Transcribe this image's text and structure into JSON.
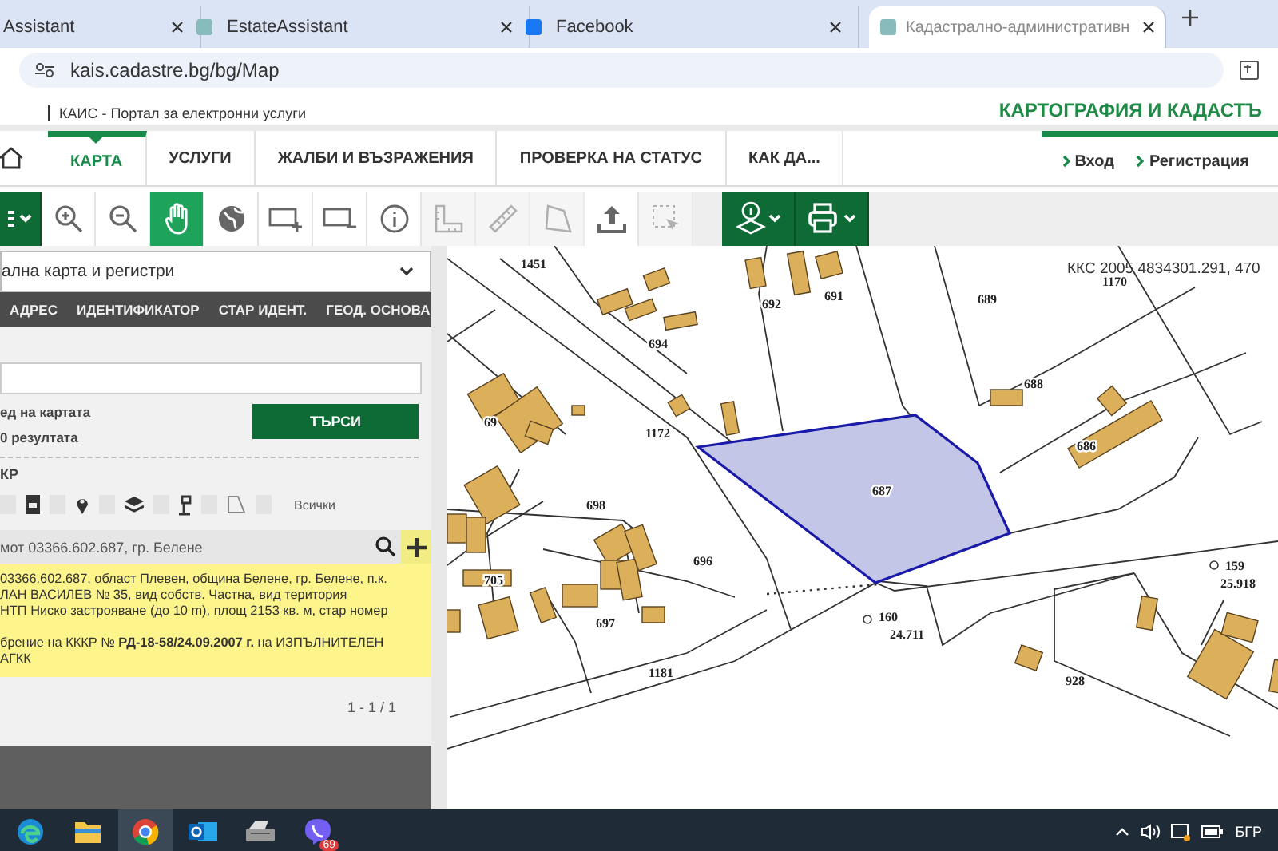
{
  "browser": {
    "tabs": [
      {
        "title": "Assistant",
        "selected": false
      },
      {
        "title": "EstateAssistant",
        "selected": false
      },
      {
        "title": "Facebook",
        "selected": false
      },
      {
        "title": "Кадастрално-административн",
        "selected": true
      }
    ],
    "url": "kais.cadastre.bg/bg/Map"
  },
  "site_header": {
    "title": "КАИС - Портал за електронни услуги",
    "agency": "КАРТОГРАФИЯ И КАДАСТЪ"
  },
  "nav": {
    "items": [
      {
        "label": "КАРТА",
        "selected": true
      },
      {
        "label": "УСЛУГИ",
        "selected": false
      },
      {
        "label": "ЖАЛБИ И ВЪЗРАЖЕНИЯ",
        "selected": false
      },
      {
        "label": "ПРОВЕРКА НА СТАТУС",
        "selected": false
      },
      {
        "label": "КАК ДА...",
        "selected": false
      }
    ],
    "links": [
      "Вход",
      "Регистрация"
    ]
  },
  "toolbar": {
    "tools": [
      {
        "kind": "menu",
        "selected": false,
        "disabled": false
      },
      {
        "kind": "zoom-in",
        "selected": false,
        "disabled": false
      },
      {
        "kind": "zoom-out",
        "selected": false,
        "disabled": false
      },
      {
        "kind": "hand",
        "selected": true,
        "disabled": false
      },
      {
        "kind": "globe",
        "selected": false,
        "disabled": false
      },
      {
        "kind": "rect-plus",
        "selected": false,
        "disabled": false
      },
      {
        "kind": "rect-minus",
        "selected": false,
        "disabled": false
      },
      {
        "kind": "info",
        "selected": false,
        "disabled": false
      },
      {
        "kind": "ruler-square",
        "selected": false,
        "disabled": true
      },
      {
        "kind": "ruler",
        "selected": false,
        "disabled": true
      },
      {
        "kind": "polygon",
        "selected": false,
        "disabled": true
      },
      {
        "kind": "upload",
        "selected": false,
        "disabled": false
      },
      {
        "kind": "select-box",
        "selected": false,
        "disabled": true
      },
      {
        "kind": "layer-info",
        "selected": false,
        "disabled": false
      },
      {
        "kind": "print",
        "selected": false,
        "disabled": false
      }
    ]
  },
  "search_panel": {
    "source": "ална карта и регистри",
    "tabs": [
      {
        "label": "АДРЕС",
        "selected": false
      },
      {
        "label": "ИДЕНТИФИКАТОР",
        "selected": false
      },
      {
        "label": "СТАР ИДЕНТ.",
        "selected": false
      },
      {
        "label": "ГЕОД. ОСНОВА",
        "selected": false
      }
    ],
    "options": [
      "ед на картата",
      "0 резултата"
    ],
    "search_button": "ТЪРСИ",
    "layer_group": "КР",
    "filters": [
      {
        "checked": false
      },
      {
        "checked": false
      },
      {
        "checked": false
      },
      {
        "checked": false
      },
      {
        "checked": false
      },
      {
        "checked": false
      }
    ],
    "filter_all": "Всички",
    "result": {
      "title": "мот 03366.602.687, гр. Белене",
      "lines": [
        "03366.602.687, област Плевен, община Белене, гр. Белене, п.к.",
        "ЛАН ВАСИЛЕВ № 35, вид собств. Частна, вид територия",
        "НТП Ниско застрояване (до 10 m), площ 2153 кв. м, стар номер",
        "брение на КККР № **РД-18-58/24.09.2007 г.** на ИЗПЪЛНИТЕЛЕН",
        "АГКК"
      ]
    },
    "pagination": "1 - 1 / 1"
  },
  "map": {
    "coordinates": "ККС 2005 4834301.291, 470",
    "labels": [
      "1451",
      "692",
      "691",
      "689",
      "1170",
      "694",
      "688",
      "69",
      "1172",
      "687",
      "686",
      "698",
      "705",
      "696",
      "697",
      "1181",
      "160",
      "24.711",
      "159",
      "25.918",
      "928"
    ]
  },
  "taskbar": {
    "apps": [
      {
        "kind": "edge",
        "selected": false
      },
      {
        "kind": "folder",
        "selected": false
      },
      {
        "kind": "chrome",
        "selected": true
      },
      {
        "kind": "outlook",
        "selected": false
      },
      {
        "kind": "printer",
        "selected": false
      },
      {
        "kind": "viber",
        "selected": false,
        "badge": "69"
      }
    ],
    "language": "БГР"
  }
}
